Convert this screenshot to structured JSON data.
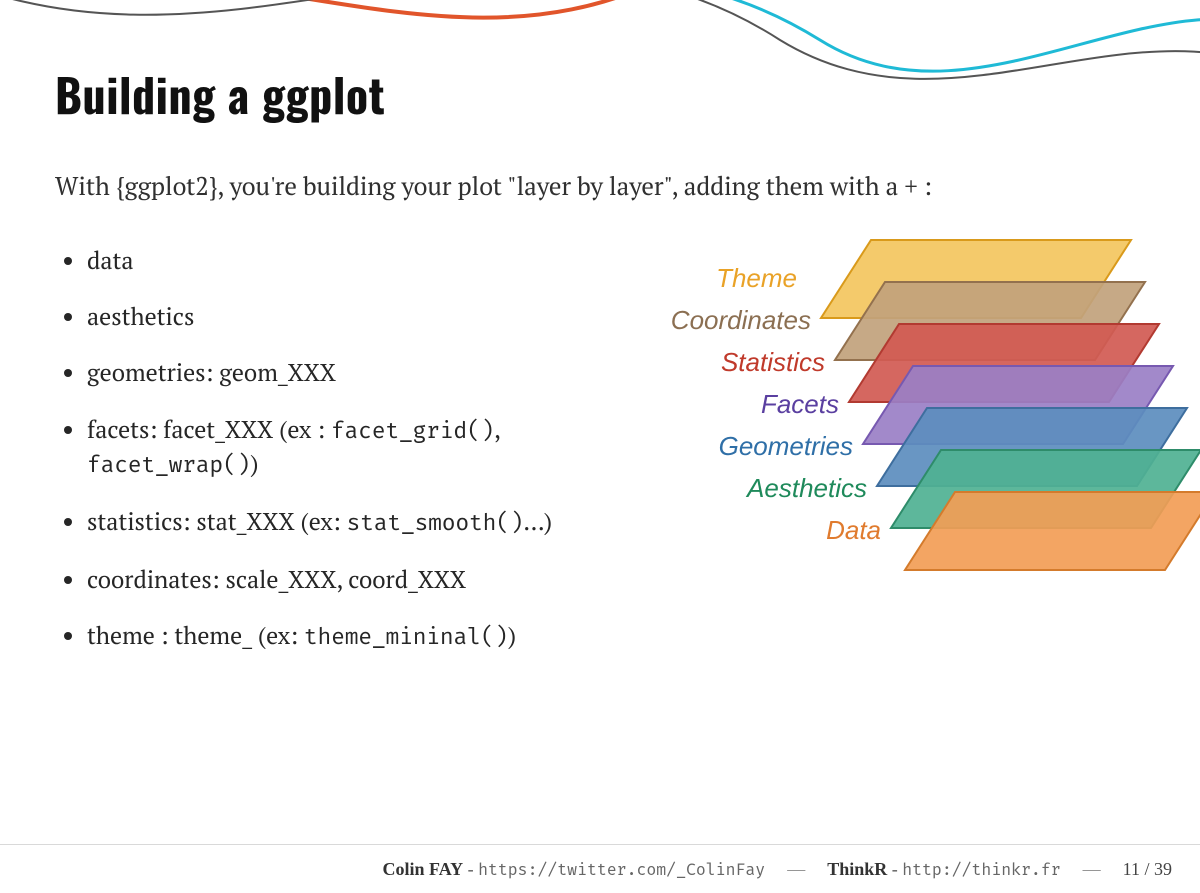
{
  "title": "Building a ggplot",
  "lead": "With {ggplot2}, you're building your plot \"layer by layer\", adding them with a + :",
  "bullets": [
    {
      "text": "data"
    },
    {
      "text": "aesthetics"
    },
    {
      "text": "geometries: geom_XXX"
    },
    {
      "text": "facets: facet_XXX (ex : ",
      "code1": "facet_grid()",
      "mid": ", ",
      "code2": "facet_wrap()",
      "tail": ")"
    },
    {
      "text": "statistics: stat_XXX (ex: ",
      "code1": "stat_smooth()",
      "tail": "…)"
    },
    {
      "text": "coordinates: scale_XXX, coord_XXX"
    },
    {
      "text": "theme : theme_ (ex: ",
      "code1": "theme_mininal()",
      "tail": ")"
    }
  ],
  "layers": [
    {
      "label": "Theme",
      "color": "#E9A227",
      "fill": "#F3C65E",
      "stroke": "#D99A1B"
    },
    {
      "label": "Coordinates",
      "color": "#8B6F52",
      "fill": "#C1A27C",
      "stroke": "#93714E"
    },
    {
      "label": "Statistics",
      "color": "#C03A2B",
      "fill": "#D15A52",
      "stroke": "#B23A31"
    },
    {
      "label": "Facets",
      "color": "#5A3FA0",
      "fill": "#9A7FC6",
      "stroke": "#7759B0"
    },
    {
      "label": "Geometries",
      "color": "#2F6FA7",
      "fill": "#5C8DBE",
      "stroke": "#3E6E9E"
    },
    {
      "label": "Aesthetics",
      "color": "#1F8A5B",
      "fill": "#4FB192",
      "stroke": "#2E8C6A"
    },
    {
      "label": "Data",
      "color": "#E07B2E",
      "fill": "#F29D56",
      "stroke": "#D47B2C"
    }
  ],
  "footer": {
    "author": "Colin FAY",
    "author_url_label": "https://twitter.com/_ColinFay",
    "org": "ThinkR",
    "org_url_label": "http://thinkr.fr",
    "page_current": "11",
    "page_total": "39"
  }
}
